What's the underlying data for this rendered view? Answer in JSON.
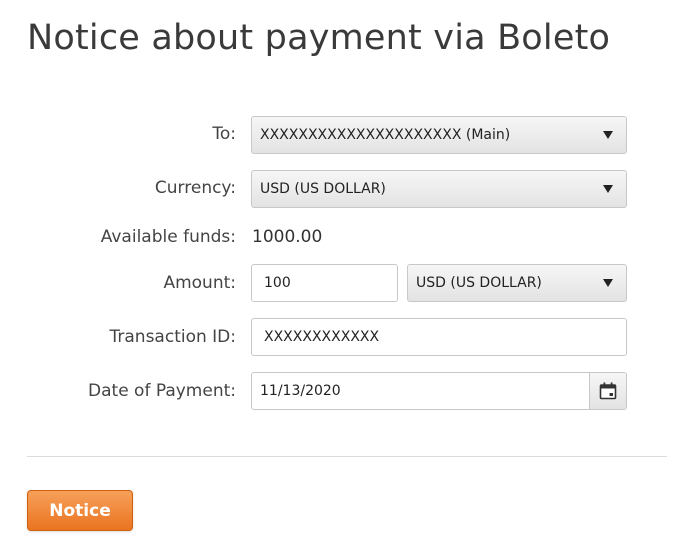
{
  "page": {
    "title": "Notice about payment via Boleto"
  },
  "form": {
    "to": {
      "label": "To:",
      "value": "XXXXXXXXXXXXXXXXXXXXX (Main)"
    },
    "currency": {
      "label": "Currency:",
      "value": "USD (US DOLLAR)"
    },
    "available_funds": {
      "label": "Available funds:",
      "value": "1000.00"
    },
    "amount": {
      "label": "Amount:",
      "value": "100",
      "currency_value": "USD (US DOLLAR)"
    },
    "transaction_id": {
      "label": "Transaction ID:",
      "value": "XXXXXXXXXXXX"
    },
    "date_of_payment": {
      "label": "Date of Payment:",
      "value": "11/13/2020",
      "icon": "calendar-icon"
    }
  },
  "actions": {
    "notice_label": "Notice"
  },
  "colors": {
    "button_accent": "#ea7420",
    "title_text": "#3a3a3a"
  }
}
